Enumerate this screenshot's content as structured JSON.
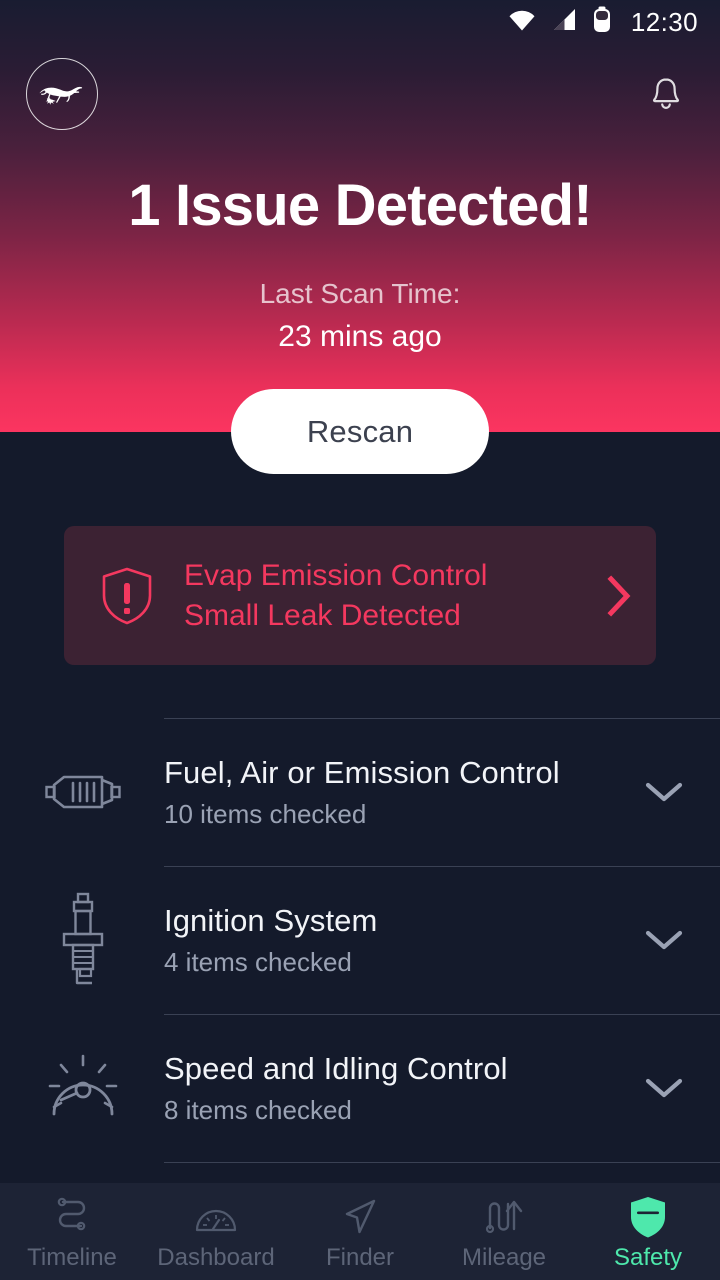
{
  "status_bar": {
    "time": "12:30",
    "icons": [
      "wifi-icon",
      "cell-signal-icon",
      "battery-icon"
    ]
  },
  "header": {
    "logo": "mustang-pony-logo",
    "notification_icon": "bell-icon"
  },
  "hero": {
    "title": "1 Issue Detected!",
    "scan_label": "Last Scan Time:",
    "scan_value": "23 mins ago",
    "rescan_label": "Rescan",
    "gradient_from": "#191c31",
    "gradient_to": "#fb3560"
  },
  "alert": {
    "icon": "shield-alert-icon",
    "line1": "Evap Emission Control",
    "line2": "Small Leak Detected",
    "chevron": "chevron-right-icon",
    "text_color": "#f4385f",
    "card_color": "#3c2233"
  },
  "systems": [
    {
      "icon": "muffler-icon",
      "title": "Fuel, Air or Emission Control",
      "subtitle": "10 items checked",
      "chevron": "chevron-down-icon"
    },
    {
      "icon": "spark-plug-icon",
      "title": "Ignition System",
      "subtitle": "4 items checked",
      "chevron": "chevron-down-icon"
    },
    {
      "icon": "gauge-icon",
      "title": "Speed and Idling Control",
      "subtitle": "8 items checked",
      "chevron": "chevron-down-icon"
    }
  ],
  "tabs": [
    {
      "label": "Timeline",
      "icon": "route-icon",
      "active": false
    },
    {
      "label": "Dashboard",
      "icon": "gauge-icon",
      "active": false
    },
    {
      "label": "Finder",
      "icon": "navigation-icon",
      "active": false
    },
    {
      "label": "Mileage",
      "icon": "road-arrow-icon",
      "active": false
    },
    {
      "label": "Safety",
      "icon": "shield-icon",
      "active": true
    }
  ],
  "theme": {
    "background": "#141a2b",
    "tabbar_background": "#1d2335",
    "accent_active": "#4ee8ac",
    "accent_inactive": "#5d6578",
    "alert_accent": "#f4385f"
  }
}
